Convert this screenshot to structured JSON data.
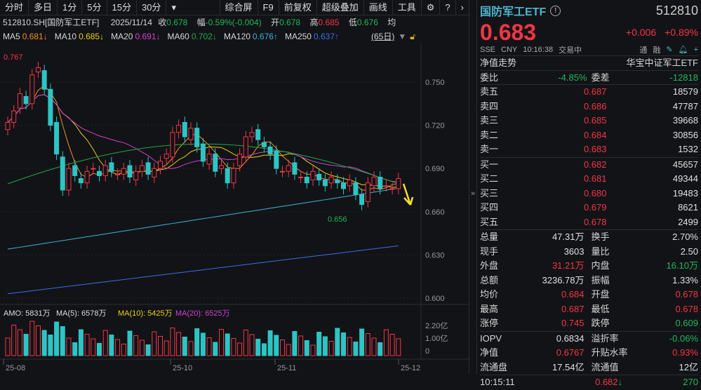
{
  "toolbar": {
    "tabs": [
      "分时",
      "多日",
      "1分",
      "5分",
      "15分",
      "30分"
    ],
    "more": "▾",
    "right": [
      "综合屏",
      "F9",
      "前复权",
      "超级叠加",
      "画线",
      "工具"
    ]
  },
  "info": {
    "symbol": "512810.SH[国防军工ETF]",
    "date": "2025/11/14",
    "close_label": "收",
    "close": "0.678",
    "chg_label": "幅",
    "chg": "-0.59%(-0.004)",
    "open_label": "开",
    "open": "0.678",
    "high_label": "高",
    "high": "0.685",
    "low_label": "低",
    "low": "0.676",
    "avg_label": "均"
  },
  "ma": [
    {
      "label": "MA5",
      "value": "0.681↓",
      "color": "#f08c2a"
    },
    {
      "label": "MA10",
      "value": "0.685↓",
      "color": "#e8d020"
    },
    {
      "label": "MA20",
      "value": "0.691↓",
      "color": "#d040d0"
    },
    {
      "label": "MA60",
      "value": "0.702↓",
      "color": "#22a845"
    },
    {
      "label": "MA120",
      "value": "0.676↑",
      "color": "#3cb4d8"
    },
    {
      "label": "MA250",
      "value": "0.637↑",
      "color": "#3a6ee8"
    }
  ],
  "period": "(65日)",
  "chart": {
    "y_ticks": [
      "0.750",
      "0.720",
      "0.690",
      "0.660",
      "0.630",
      "0.600"
    ],
    "max_label": "0.767",
    "min_label": "0.656",
    "x_ticks": [
      "25-08",
      "25-10",
      "25-11",
      "25-12"
    ],
    "amo": {
      "label": "AMO: 5831万",
      "ma5": "MA(5): 6578万",
      "ma10": "MA(10): 5425万",
      "ma20": "MA(20): 6525万"
    },
    "vol_ticks": [
      "2.20亿",
      "1.00亿",
      "0"
    ],
    "closes": [
      0.722,
      0.73,
      0.742,
      0.735,
      0.755,
      0.76,
      0.745,
      0.72,
      0.7,
      0.675,
      0.69,
      0.685,
      0.68,
      0.688,
      0.69,
      0.685,
      0.692,
      0.688,
      0.686,
      0.69,
      0.684,
      0.688,
      0.692,
      0.686,
      0.69,
      0.695,
      0.7,
      0.715,
      0.72,
      0.712,
      0.718,
      0.705,
      0.695,
      0.7,
      0.688,
      0.692,
      0.68,
      0.69,
      0.7,
      0.712,
      0.715,
      0.71,
      0.705,
      0.7,
      0.69,
      0.688,
      0.692,
      0.686,
      0.684,
      0.68,
      0.688,
      0.682,
      0.678,
      0.684,
      0.68,
      0.676,
      0.682,
      0.672,
      0.665,
      0.68,
      0.684,
      0.676,
      0.678,
      0.676,
      0.683
    ]
  },
  "quote": {
    "name": "国防军工ETF",
    "code": "512810",
    "price": "0.683",
    "change": "+0.006",
    "pct": "+0.89%",
    "market": "SSE",
    "currency": "CNY",
    "time": "10:16:38",
    "status": "交易中",
    "tag1": "通",
    "tag2": "融",
    "nav_trend": "净值走势",
    "fund_name": "华宝中证军工ETF"
  },
  "book": {
    "wb_label": "委比",
    "wb": "-4.85%",
    "wc_label": "委差",
    "wc": "-12818",
    "asks": [
      [
        "卖五",
        "0.687",
        "18579"
      ],
      [
        "卖四",
        "0.686",
        "47787"
      ],
      [
        "卖三",
        "0.685",
        "39668"
      ],
      [
        "卖二",
        "0.684",
        "30856"
      ],
      [
        "卖一",
        "0.683",
        "1532"
      ]
    ],
    "bids": [
      [
        "买一",
        "0.682",
        "45657"
      ],
      [
        "买二",
        "0.681",
        "49344"
      ],
      [
        "买三",
        "0.680",
        "19483"
      ],
      [
        "买四",
        "0.679",
        "8621"
      ],
      [
        "买五",
        "0.678",
        "2499"
      ]
    ]
  },
  "stats": [
    [
      [
        "总量",
        "47.31万",
        "w"
      ],
      [
        "换手",
        "2.70%",
        "w"
      ]
    ],
    [
      [
        "现手",
        "3603",
        "w"
      ],
      [
        "量比",
        "2.50",
        "w"
      ]
    ],
    [
      [
        "外盘",
        "31.21万",
        "r"
      ],
      [
        "内盘",
        "16.10万",
        "g"
      ]
    ],
    [
      [
        "总额",
        "3236.78万",
        "w"
      ],
      [
        "振幅",
        "1.33%",
        "w"
      ]
    ],
    [
      [
        "均价",
        "0.684",
        "r"
      ],
      [
        "开盘",
        "0.678",
        "r"
      ]
    ],
    [
      [
        "最高",
        "0.687",
        "r"
      ],
      [
        "最低",
        "0.678",
        "r"
      ]
    ],
    [
      [
        "涨停",
        "0.745",
        "r"
      ],
      [
        "跌停",
        "0.609",
        "g"
      ]
    ]
  ],
  "stats2": [
    [
      [
        "IOPV",
        "0.6834",
        "w"
      ],
      [
        "溢折率",
        "-0.06%",
        "g"
      ]
    ],
    [
      [
        "净值",
        "0.6767",
        "r"
      ],
      [
        "升贴水率",
        "0.93%",
        "r"
      ]
    ],
    [
      [
        "流通盘",
        "17.54亿",
        "w"
      ],
      [
        "流通值",
        "12亿",
        "w"
      ]
    ]
  ],
  "tick": {
    "time": "10:15:11",
    "price": "0.682",
    "vol": "270"
  }
}
